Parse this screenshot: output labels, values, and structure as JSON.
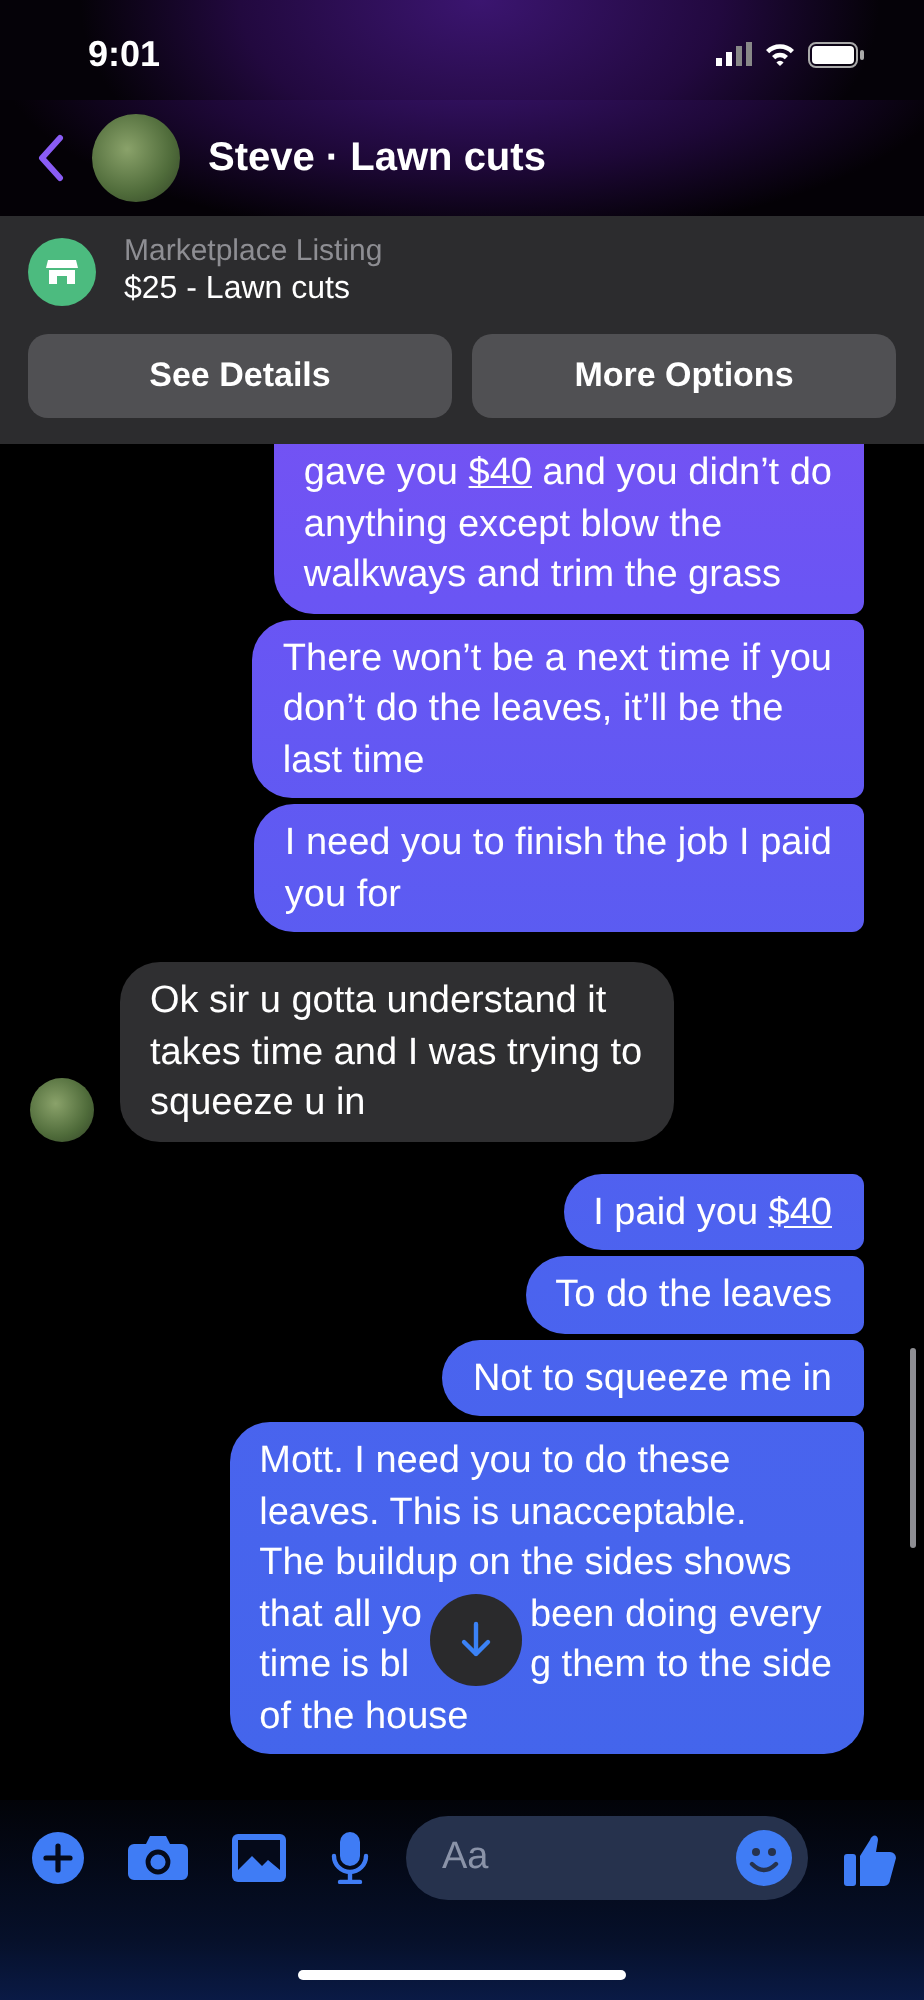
{
  "status_bar": {
    "time": "9:01"
  },
  "header": {
    "title": "Steve · Lawn cuts"
  },
  "listing": {
    "label": "Marketplace Listing",
    "title": "$25 - Lawn cuts",
    "buttons": [
      "See Details",
      "More Options"
    ]
  },
  "messages": [
    {
      "kind": "outgoing",
      "lines": [
        [
          {
            "kind": "text",
            "text": "gave you "
          },
          {
            "kind": "link",
            "text": "$40"
          },
          {
            "kind": "text",
            "text": " and you didn’t do"
          }
        ],
        [
          {
            "kind": "text",
            "text": "anything except blow the"
          }
        ],
        [
          {
            "kind": "text",
            "text": "walkways and trim the grass"
          }
        ]
      ]
    },
    {
      "kind": "outgoing",
      "lines": [
        [
          {
            "kind": "text",
            "text": "There won’t be a next time if you"
          }
        ],
        [
          {
            "kind": "text",
            "text": "don’t do the leaves, it’ll be the"
          }
        ],
        [
          {
            "kind": "text",
            "text": "last time"
          }
        ]
      ]
    },
    {
      "kind": "outgoing",
      "lines": [
        [
          {
            "kind": "text",
            "text": "I need you to finish the job I paid"
          }
        ],
        [
          {
            "kind": "text",
            "text": "you for"
          }
        ]
      ]
    },
    {
      "kind": "incoming",
      "lines": [
        [
          {
            "kind": "text",
            "text": "Ok sir u gotta understand it"
          }
        ],
        [
          {
            "kind": "text",
            "text": "takes time and I was trying to"
          }
        ],
        [
          {
            "kind": "text",
            "text": "squeeze u in"
          }
        ]
      ]
    },
    {
      "kind": "outgoing",
      "lines": [
        [
          {
            "kind": "text",
            "text": "I paid you "
          },
          {
            "kind": "link",
            "text": "$40"
          }
        ]
      ]
    },
    {
      "kind": "outgoing",
      "lines": [
        [
          {
            "kind": "text",
            "text": "To do the leaves"
          }
        ]
      ]
    },
    {
      "kind": "outgoing",
      "lines": [
        [
          {
            "kind": "text",
            "text": "Not to squeeze me in"
          }
        ]
      ]
    },
    {
      "kind": "outgoing",
      "lines": [
        [
          {
            "kind": "text",
            "text": "Mott. I need you to do these"
          }
        ],
        [
          {
            "kind": "text",
            "text": "leaves. This is unacceptable."
          }
        ],
        [
          {
            "kind": "text",
            "text": "The buildup on the sides shows"
          }
        ],
        [
          {
            "kind": "text",
            "text": "that all yo"
          },
          {
            "kind": "covered"
          },
          {
            "kind": "text",
            "text": "been doing every"
          }
        ],
        [
          {
            "kind": "text",
            "text": "time is bl"
          },
          {
            "kind": "covered"
          },
          {
            "kind": "text",
            "text": "g them to the side"
          }
        ],
        [
          {
            "kind": "text",
            "text": "of the house"
          }
        ]
      ]
    }
  ],
  "composer": {
    "placeholder": "Aa"
  }
}
